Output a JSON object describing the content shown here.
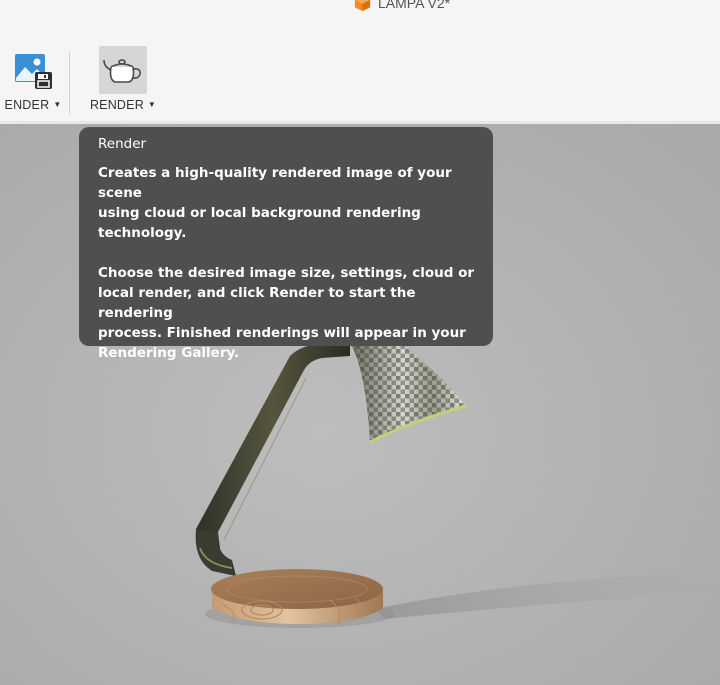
{
  "app": {
    "document_title": "LAMPA V2*"
  },
  "toolbar": {
    "groups": [
      {
        "label": "ENDER",
        "icon": "save-image-icon",
        "has_dropdown": true
      },
      {
        "label": "RENDER",
        "icon": "teapot-icon",
        "has_dropdown": true,
        "highlighted": true
      }
    ]
  },
  "tooltip": {
    "title": "Render",
    "paragraph_1": "Creates a high-quality rendered image of your scene\nusing cloud or local background rendering\ntechnology.",
    "paragraph_2": "Choose the desired image size, settings, cloud or\nlocal render, and click Render to start the rendering\nprocess. Finished renderings will appear in your\nRendering Gallery."
  },
  "colors": {
    "toolbar_bg": "#f5f5f5",
    "viewport_bg": "#b2b2b2",
    "tooltip_bg": "#4f4f4f",
    "tooltip_text": "#ffffff",
    "brand_orange": "#f58a1f",
    "save_icon_blue": "#3a8fd6"
  },
  "viewport": {
    "scene": "Rendered desk lamp with wooden base and metallic shade"
  }
}
